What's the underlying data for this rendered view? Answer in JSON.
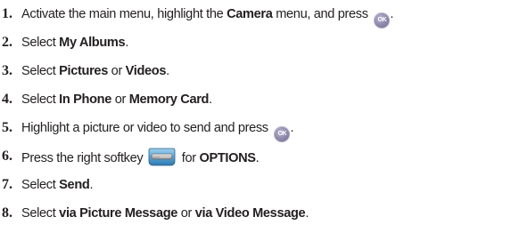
{
  "steps": [
    {
      "number": "1.",
      "text_a": "Activate the main menu, highlight the ",
      "bold_a": "Camera",
      "text_b": " menu, and press ",
      "icon": "ok-key-icon",
      "icon_label": "OK",
      "text_c": "."
    },
    {
      "number": "2.",
      "text_a": "Select ",
      "bold_a": "My Albums",
      "text_b": "."
    },
    {
      "number": "3.",
      "text_a": "Select ",
      "bold_a": "Pictures",
      "text_b": " or ",
      "bold_b": "Videos",
      "text_c": "."
    },
    {
      "number": "4.",
      "text_a": "Select ",
      "bold_a": "In Phone",
      "text_b": " or ",
      "bold_b": "Memory Card",
      "text_c": "."
    },
    {
      "number": "5.",
      "text_a": "Highlight a picture or video to send and press ",
      "icon": "ok-key-icon",
      "icon_label": "OK",
      "text_b": "."
    },
    {
      "number": "6.",
      "text_a": "Press the right softkey ",
      "icon": "right-softkey-icon",
      "text_b": " for ",
      "bold_a": "OPTIONS",
      "text_c": "."
    },
    {
      "number": "7.",
      "text_a": "Select ",
      "bold_a": "Send",
      "text_b": "."
    },
    {
      "number": "8.",
      "text_a": "Select ",
      "bold_a": "via Picture Message",
      "text_b": " or ",
      "bold_b": "via Video Message",
      "text_c": "."
    }
  ],
  "colors": {
    "text": "#231f20",
    "ok_key": "#8a84a8",
    "softkey_body": "#5aa6d6"
  }
}
